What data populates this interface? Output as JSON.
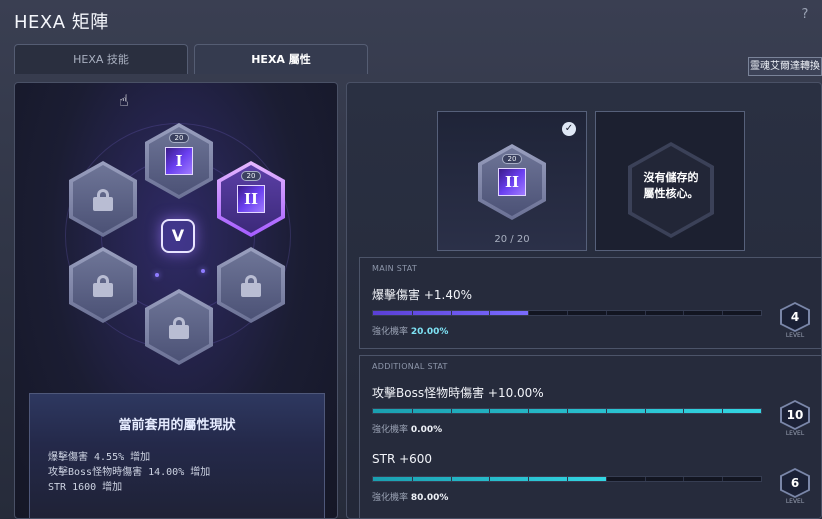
{
  "window": {
    "title": "HEXA 矩陣",
    "help_label": "?"
  },
  "tabs": [
    {
      "label": "HEXA 技能"
    },
    {
      "label": "HEXA 屬性"
    }
  ],
  "corner_button": "靈魂艾爾達轉換",
  "board": {
    "cores": [
      {
        "numeral": "I",
        "level": "20"
      },
      {
        "numeral": "II",
        "level": "20"
      }
    ],
    "center_emblem": "V"
  },
  "summary": {
    "title": "當前套用的屬性現狀",
    "lines": [
      "爆擊傷害 4.55% 增加",
      "攻擊Boss怪物時傷害 14.00% 增加",
      "STR 1600 增加"
    ]
  },
  "slots": {
    "equipped": {
      "numeral": "II",
      "level": "20",
      "count": "20 / 20"
    },
    "empty_text_line1": "沒有儲存的",
    "empty_text_line2": "屬性核心。"
  },
  "main_stat": {
    "section_label": "MAIN STAT",
    "name": "爆擊傷害 +1.40%",
    "rate_label": "強化機率",
    "rate_value": "20.00%",
    "level": "4",
    "level_word": "LEVEL",
    "progress": 0.4
  },
  "additional_stat": {
    "section_label": "ADDITIONAL STAT",
    "stats": [
      {
        "name": "攻擊Boss怪物時傷害 +10.00%",
        "rate_label": "強化機率",
        "rate_value": "0.00%",
        "level": "10",
        "level_word": "LEVEL",
        "progress": 1.0
      },
      {
        "name": "STR +600",
        "rate_label": "強化機率",
        "rate_value": "80.00%",
        "level": "6",
        "level_word": "LEVEL",
        "progress": 0.6
      }
    ]
  },
  "colors": {
    "accent_purple": "#7a6cff",
    "accent_cyan": "#33d6e3",
    "selected_glow": "#a45cff"
  }
}
